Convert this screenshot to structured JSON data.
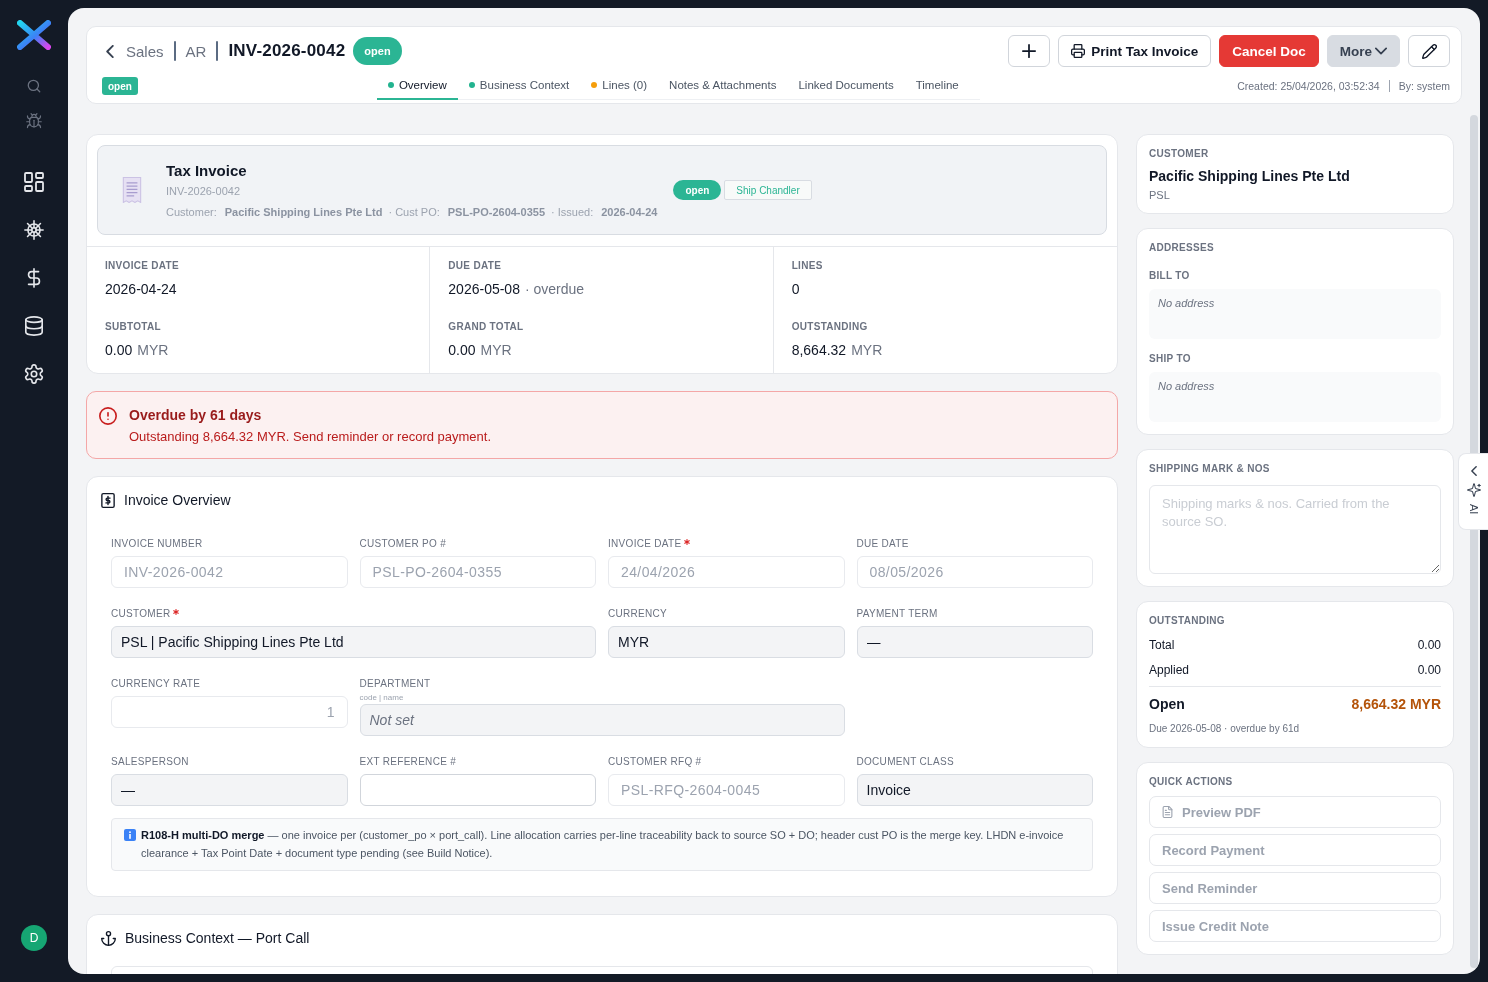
{
  "sidebar": {
    "avatar": "D"
  },
  "header": {
    "breadcrumb": [
      "Sales",
      "AR"
    ],
    "title": "INV-2026-0042",
    "status": "open",
    "buttons": [
      {
        "kind": "add"
      },
      {
        "kind": "print",
        "label": "Print Tax Invoice"
      },
      {
        "kind": "danger",
        "label": "Cancel Doc"
      },
      {
        "kind": "menu",
        "label": "More"
      },
      {
        "kind": "edit"
      }
    ],
    "status_tag": "open",
    "tabs": [
      {
        "label": "Overview",
        "selected": true,
        "color": "#22b38f"
      },
      {
        "label": "Business Context",
        "selected": false,
        "color": "#22b38f"
      },
      {
        "label": "Lines (0)",
        "selected": false,
        "color": "#f59e0b"
      },
      {
        "label": "Notes & Attachments",
        "selected": false
      },
      {
        "label": "Linked Documents",
        "selected": false
      },
      {
        "label": "Timeline",
        "selected": false
      }
    ],
    "created": "Created: 25/04/2026, 03:52:34",
    "created_by": "By: system"
  },
  "summary": {
    "title": "Tax Invoice",
    "number": "INV-2026-0042",
    "meta": [
      {
        "label": "Customer:",
        "value": "Pacific Shipping Lines Pte Ltd"
      },
      {
        "label": "· Cust PO:",
        "value": "PSL-PO-2604-0355"
      },
      {
        "label": "· Issued:",
        "value": "2026-04-24"
      }
    ],
    "status": "open",
    "tag": "Ship Chandler",
    "stats": [
      {
        "label": "INVOICE DATE",
        "value": "2026-04-24"
      },
      {
        "label": "DUE DATE",
        "value": "2026-05-08",
        "note": "· overdue"
      },
      {
        "label": "LINES",
        "value": "0"
      },
      {
        "label": "SUBTOTAL",
        "value": "0.00",
        "note": "MYR"
      },
      {
        "label": "GRAND TOTAL",
        "value": "0.00",
        "note": "MYR"
      },
      {
        "label": "OUTSTANDING",
        "value": "8,664.32",
        "note": "MYR"
      }
    ]
  },
  "alert": {
    "title": "Overdue by 61 days",
    "message": "Outstanding 8,664.32 MYR. Send reminder or record payment."
  },
  "invoice_overview": {
    "title": "Invoice Overview",
    "fields": [
      {
        "label": "INVOICE NUMBER",
        "required": false,
        "kind": "input",
        "disabled": true,
        "value": "INV-2026-0042"
      },
      {
        "label": "CUSTOMER PO #",
        "required": false,
        "kind": "input",
        "disabled": true,
        "value": "PSL-PO-2604-0355"
      },
      {
        "label": "INVOICE DATE",
        "required": true,
        "kind": "input",
        "disabled": true,
        "value": "24/04/2026"
      },
      {
        "label": "DUE DATE",
        "required": false,
        "kind": "input",
        "disabled": true,
        "value": "08/05/2026"
      },
      {
        "label": "CUSTOMER",
        "required": true,
        "kind": "lookup",
        "disabled": false,
        "value": "PSL | Pacific Shipping Lines Pte Ltd"
      },
      {
        "label": "CURRENCY",
        "required": false,
        "kind": "lookup",
        "disabled": false,
        "value": "MYR"
      },
      {
        "label": "PAYMENT TERM",
        "required": false,
        "kind": "lookup",
        "disabled": false,
        "value": "—"
      },
      {
        "label": "CURRENCY RATE",
        "required": false,
        "kind": "number",
        "disabled": true,
        "value": "1"
      },
      {
        "label": "DEPARTMENT",
        "required": false,
        "kind": "lookup",
        "disabled": false,
        "hint": "code | name",
        "placeholder": "Not set"
      },
      {
        "label": "SALESPERSON",
        "required": false,
        "kind": "lookup",
        "disabled": false,
        "value": "—"
      },
      {
        "label": "EXT REFERENCE #",
        "required": false,
        "kind": "input",
        "disabled": false
      },
      {
        "label": "CUSTOMER RFQ #",
        "required": false,
        "kind": "input",
        "disabled": true,
        "value": "PSL-RFQ-2604-0045"
      },
      {
        "label": "DOCUMENT CLASS",
        "required": false,
        "kind": "lookup",
        "disabled": false,
        "value": "Invoice"
      }
    ],
    "note": "**R108-H multi-DO merge** — one invoice per (customer_po × port_call). Line allocation carries per-line traceability back to source SO + DO; header cust PO is the merge key. LHDN e-invoice clearance + Tax Point Date + document type pending (see Build Notice)."
  },
  "business_context": {
    "title": "Business Context — Port Call"
  },
  "customer": {
    "label": "CUSTOMER",
    "name": "Pacific Shipping Lines Pte Ltd",
    "code": "PSL"
  },
  "addresses": {
    "label": "ADDRESSES",
    "items": [
      {
        "label": "BILL TO",
        "value": "No address"
      },
      {
        "label": "SHIP TO",
        "value": "No address"
      }
    ]
  },
  "shipping_mark": {
    "label": "SHIPPING MARK & NOS",
    "placeholder": "Shipping marks & nos. Carried from the source SO."
  },
  "outstanding": {
    "label": "OUTSTANDING",
    "rows": [
      {
        "label": "Total",
        "value": "0.00"
      },
      {
        "label": "Applied",
        "value": "0.00"
      }
    ],
    "open_label": "Open",
    "open_value": "8,664.32 MYR",
    "due": "Due 2026-05-08 · overdue by 61d"
  },
  "quick_actions": {
    "label": "QUICK ACTIONS",
    "buttons": [
      {
        "label": "Preview PDF",
        "kind": "document",
        "disabled": true
      },
      {
        "label": "Record Payment",
        "kind": "plain",
        "disabled": true
      },
      {
        "label": "Send Reminder",
        "kind": "plain",
        "disabled": true
      },
      {
        "label": "Issue Credit Note",
        "kind": "plain",
        "disabled": true
      }
    ]
  },
  "ai_tab": {
    "label": "AI"
  }
}
